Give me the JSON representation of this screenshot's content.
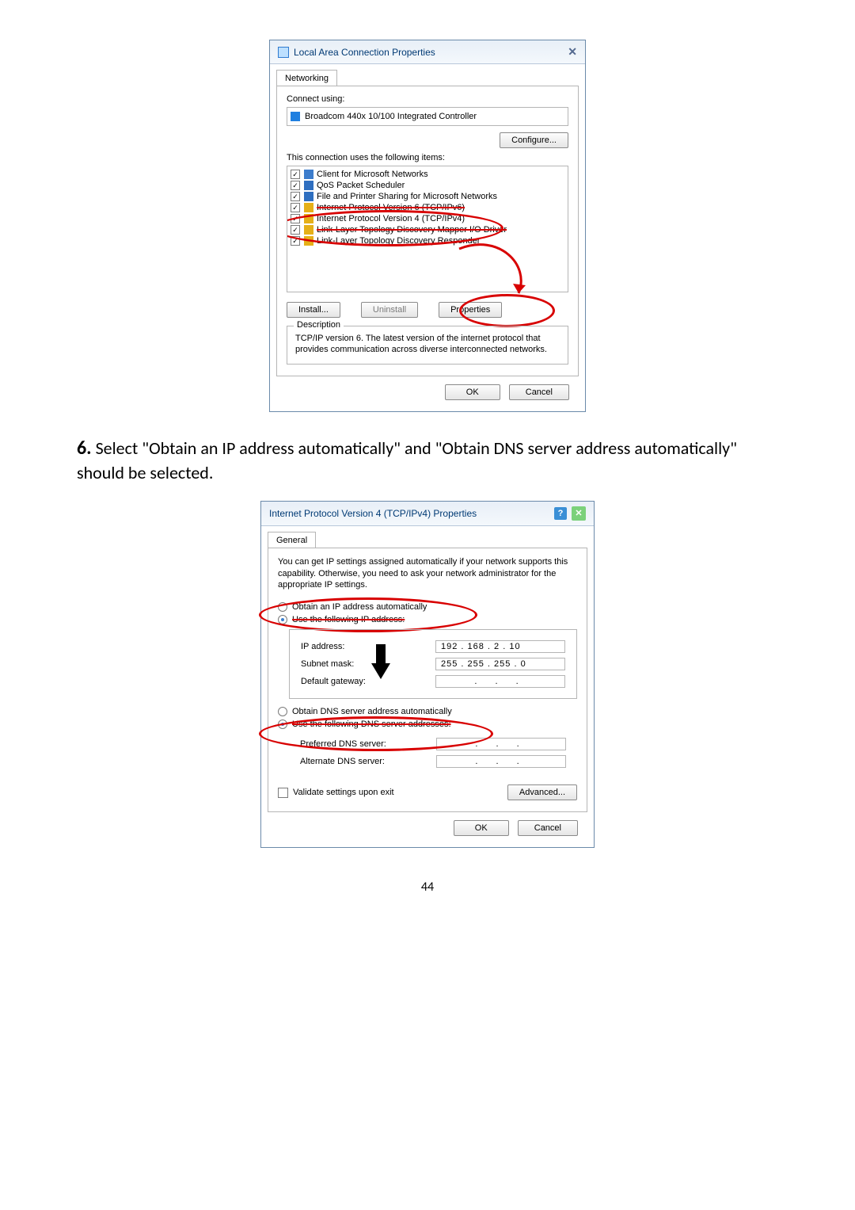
{
  "dialog1": {
    "title": "Local Area Connection Properties",
    "tab": "Networking",
    "connect_using_label": "Connect using:",
    "adapter_name": "Broadcom 440x 10/100 Integrated Controller",
    "configure_btn": "Configure...",
    "items_label": "This connection uses the following items:",
    "items": [
      {
        "label": "Client for Microsoft Networks",
        "checked": true,
        "icon": "monitor"
      },
      {
        "label": "QoS Packet Scheduler",
        "checked": true,
        "icon": "qos"
      },
      {
        "label": "File and Printer Sharing for Microsoft Networks",
        "checked": true,
        "icon": "file"
      },
      {
        "label": "Internet Protocol Version 6 (TCP/IPv6)",
        "checked": true,
        "icon": "proto",
        "strike": true
      },
      {
        "label": "Internet Protocol Version 4 (TCP/IPv4)",
        "checked": true,
        "icon": "proto"
      },
      {
        "label": "Link-Layer Topology Discovery Mapper I/O Driver",
        "checked": true,
        "icon": "proto",
        "strike": true
      },
      {
        "label": "Link-Layer Topology Discovery Responder",
        "checked": true,
        "icon": "proto"
      }
    ],
    "install_btn": "Install...",
    "uninstall_btn": "Uninstall",
    "properties_btn": "Properties",
    "desc_title": "Description",
    "desc_text": "TCP/IP version 6. The latest version of the internet protocol that provides communication across diverse interconnected networks.",
    "ok_btn": "OK",
    "cancel_btn": "Cancel"
  },
  "instruction": {
    "step_num": "6.",
    "text": "Select \"Obtain an IP address automatically\" and \"Obtain DNS server address automatically\" should be selected."
  },
  "dialog2": {
    "title": "Internet Protocol Version 4 (TCP/IPv4) Properties",
    "tab": "General",
    "intro": "You can get IP settings assigned automatically if your network supports this capability. Otherwise, you need to ask your network administrator for the appropriate IP settings.",
    "opt_ip_auto": "Obtain an IP address automatically",
    "opt_ip_manual": "Use the following IP address:",
    "ip_addr_label": "IP address:",
    "ip_addr_value": "192 . 168 .  2  . 10",
    "subnet_label": "Subnet mask:",
    "subnet_value": "255 . 255 . 255 .  0",
    "gateway_label": "Default gateway:",
    "gateway_value": ".       .       .",
    "opt_dns_auto": "Obtain DNS server address automatically",
    "opt_dns_manual": "Use the following DNS server addresses:",
    "pref_dns_label": "Preferred DNS server:",
    "pref_dns_value": ".       .       .",
    "alt_dns_label": "Alternate DNS server:",
    "alt_dns_value": ".       .       .",
    "validate_label": "Validate settings upon exit",
    "advanced_btn": "Advanced...",
    "ok_btn": "OK",
    "cancel_btn": "Cancel"
  },
  "page_number": "44"
}
